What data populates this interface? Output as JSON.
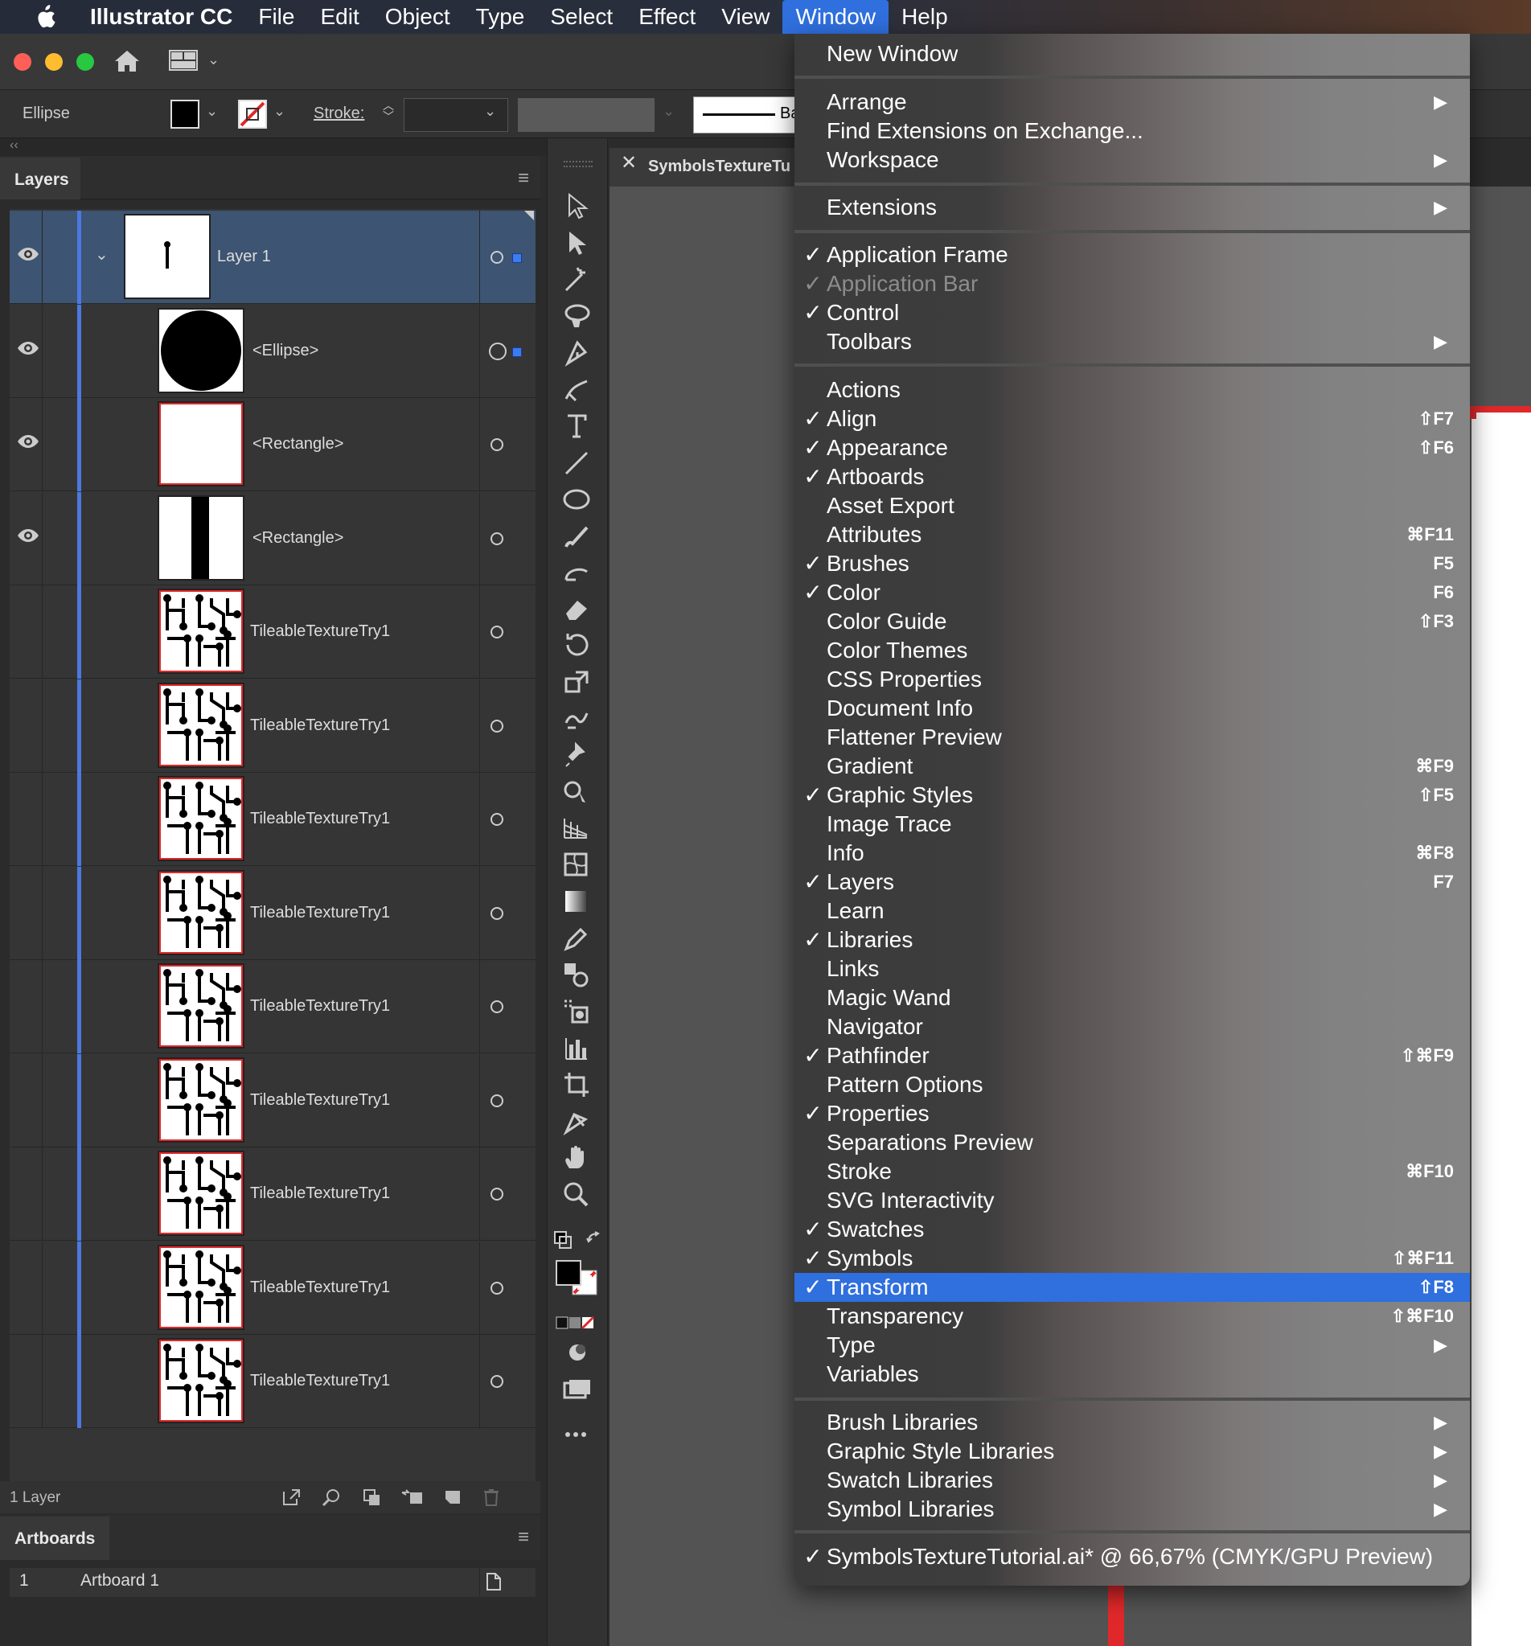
{
  "menubar": {
    "app_name": "Illustrator CC",
    "items": [
      "File",
      "Edit",
      "Object",
      "Type",
      "Select",
      "Effect",
      "View",
      "Window",
      "Help"
    ],
    "active": "Window"
  },
  "control_bar": {
    "selection_label": "Ellipse",
    "stroke_label": "Stroke:",
    "brush_text": "Ba"
  },
  "layers_panel": {
    "tab": "Layers",
    "rows": [
      {
        "name": "Layer 1"
      },
      {
        "name": "<Ellipse>"
      },
      {
        "name": "<Rectangle>"
      },
      {
        "name": "<Rectangle>"
      },
      {
        "name": "TileableTextureTry1"
      },
      {
        "name": "TileableTextureTry1"
      },
      {
        "name": "TileableTextureTry1"
      },
      {
        "name": "TileableTextureTry1"
      },
      {
        "name": "TileableTextureTry1"
      },
      {
        "name": "TileableTextureTry1"
      },
      {
        "name": "TileableTextureTry1"
      },
      {
        "name": "TileableTextureTry1"
      },
      {
        "name": "TileableTextureTry1"
      }
    ],
    "footer_label": "1 Layer"
  },
  "artboards_panel": {
    "tab": "Artboards",
    "rows": [
      {
        "number": "1",
        "name": "Artboard 1"
      }
    ]
  },
  "document": {
    "tab_title": "SymbolsTextureTu"
  },
  "window_menu": {
    "items": [
      {
        "label": "New Window"
      },
      {
        "label": "Arrange",
        "submenu": true
      },
      {
        "label": "Find Extensions on Exchange..."
      },
      {
        "label": "Workspace",
        "submenu": true
      },
      {
        "label": "Extensions",
        "submenu": true
      },
      {
        "label": "Application Frame",
        "checked": true
      },
      {
        "label": "Application Bar",
        "checked": true,
        "disabled": true
      },
      {
        "label": "Control",
        "checked": true
      },
      {
        "label": "Toolbars",
        "submenu": true
      },
      {
        "label": "Actions"
      },
      {
        "label": "Align",
        "checked": true,
        "shortcut": "⇧F7"
      },
      {
        "label": "Appearance",
        "checked": true,
        "shortcut": "⇧F6"
      },
      {
        "label": "Artboards",
        "checked": true
      },
      {
        "label": "Asset Export"
      },
      {
        "label": "Attributes",
        "shortcut": "⌘F11"
      },
      {
        "label": "Brushes",
        "checked": true,
        "shortcut": "F5"
      },
      {
        "label": "Color",
        "checked": true,
        "shortcut": "F6"
      },
      {
        "label": "Color Guide",
        "shortcut": "⇧F3"
      },
      {
        "label": "Color Themes"
      },
      {
        "label": "CSS Properties"
      },
      {
        "label": "Document Info"
      },
      {
        "label": "Flattener Preview"
      },
      {
        "label": "Gradient",
        "shortcut": "⌘F9"
      },
      {
        "label": "Graphic Styles",
        "checked": true,
        "shortcut": "⇧F5"
      },
      {
        "label": "Image Trace"
      },
      {
        "label": "Info",
        "shortcut": "⌘F8"
      },
      {
        "label": "Layers",
        "checked": true,
        "shortcut": "F7"
      },
      {
        "label": "Learn"
      },
      {
        "label": "Libraries",
        "checked": true
      },
      {
        "label": "Links"
      },
      {
        "label": "Magic Wand"
      },
      {
        "label": "Navigator"
      },
      {
        "label": "Pathfinder",
        "checked": true,
        "shortcut": "⇧⌘F9"
      },
      {
        "label": "Pattern Options"
      },
      {
        "label": "Properties",
        "checked": true
      },
      {
        "label": "Separations Preview"
      },
      {
        "label": "Stroke",
        "shortcut": "⌘F10"
      },
      {
        "label": "SVG Interactivity"
      },
      {
        "label": "Swatches",
        "checked": true
      },
      {
        "label": "Symbols",
        "checked": true,
        "shortcut": "⇧⌘F11"
      },
      {
        "label": "Transform",
        "checked": true,
        "shortcut": "⇧F8",
        "highlighted": true
      },
      {
        "label": "Transparency",
        "shortcut": "⇧⌘F10"
      },
      {
        "label": "Type",
        "submenu": true
      },
      {
        "label": "Variables"
      },
      {
        "label": "Brush Libraries",
        "submenu": true
      },
      {
        "label": "Graphic Style Libraries",
        "submenu": true
      },
      {
        "label": "Swatch Libraries",
        "submenu": true
      },
      {
        "label": "Symbol Libraries",
        "submenu": true
      },
      {
        "label": "SymbolsTextureTutorial.ai* @ 66,67% (CMYK/GPU Preview)",
        "checked": true
      }
    ]
  },
  "colors": {
    "menu_highlight": "#2f6fde",
    "layer_color": "#4c78e0",
    "selected_row": "#3d5472"
  }
}
